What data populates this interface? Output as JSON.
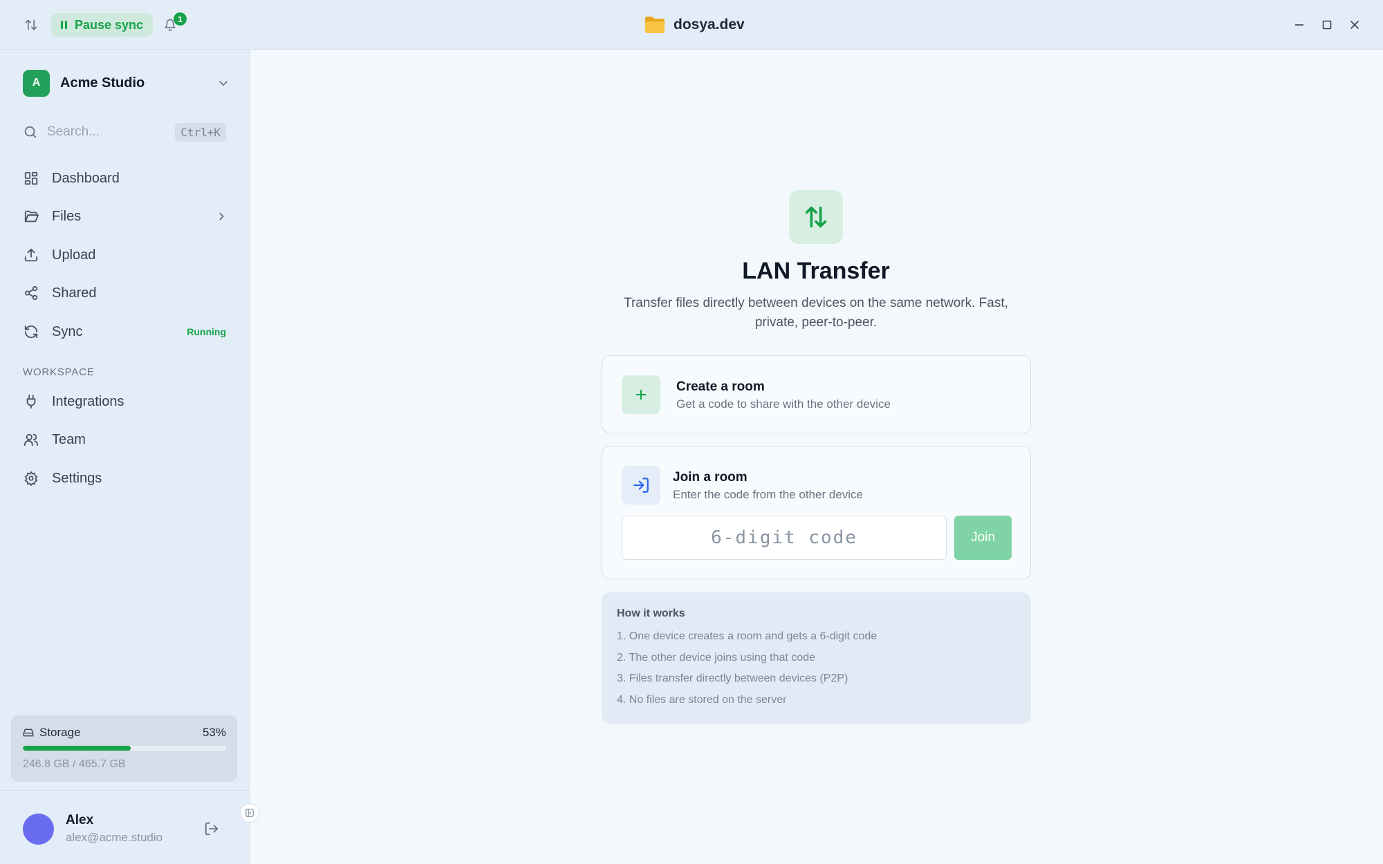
{
  "titlebar": {
    "pause_sync_label": "Pause sync",
    "notification_count": "1",
    "window_title": "dosya.dev"
  },
  "sidebar": {
    "workspace": {
      "avatar_letter": "A",
      "name": "Acme Studio"
    },
    "search": {
      "placeholder": "Search...",
      "shortcut": "Ctrl+K"
    },
    "items": [
      {
        "label": "Dashboard",
        "icon": "grid-icon"
      },
      {
        "label": "Files",
        "icon": "folder-icon"
      },
      {
        "label": "Upload",
        "icon": "upload-icon"
      },
      {
        "label": "Shared",
        "icon": "share-icon"
      },
      {
        "label": "Sync",
        "icon": "sync-icon",
        "status": "Running"
      }
    ],
    "section_label": "WORKSPACE",
    "workspace_items": [
      {
        "label": "Integrations",
        "icon": "plug-icon"
      },
      {
        "label": "Team",
        "icon": "users-icon"
      },
      {
        "label": "Settings",
        "icon": "gear-icon"
      }
    ],
    "storage": {
      "label": "Storage",
      "percent_text": "53%",
      "percent": 53,
      "used_text": "246.8 GB / 465.7 GB"
    },
    "user": {
      "name": "Alex",
      "email": "alex@acme.studio"
    }
  },
  "main": {
    "title": "LAN Transfer",
    "subtitle_line1": "Transfer files directly between devices on the same network. Fast,",
    "subtitle_line2": "private, peer-to-peer.",
    "create": {
      "title": "Create a room",
      "subtitle": "Get a code to share with the other device"
    },
    "join": {
      "title": "Join a room",
      "subtitle": "Enter the code from the other device",
      "placeholder": "6-digit code",
      "button": "Join"
    },
    "how": {
      "title": "How it works",
      "steps": [
        "1. One device creates a room and gets a 6-digit code",
        "2. The other device joins using that code",
        "3. Files transfer directly between devices (P2P)",
        "4. No files are stored on the server"
      ]
    }
  },
  "colors": {
    "accent": "#16a34a",
    "sidebar_bg": "#e3edf7",
    "main_bg": "#f3f8fc",
    "avatar": "#6a6cf0"
  }
}
